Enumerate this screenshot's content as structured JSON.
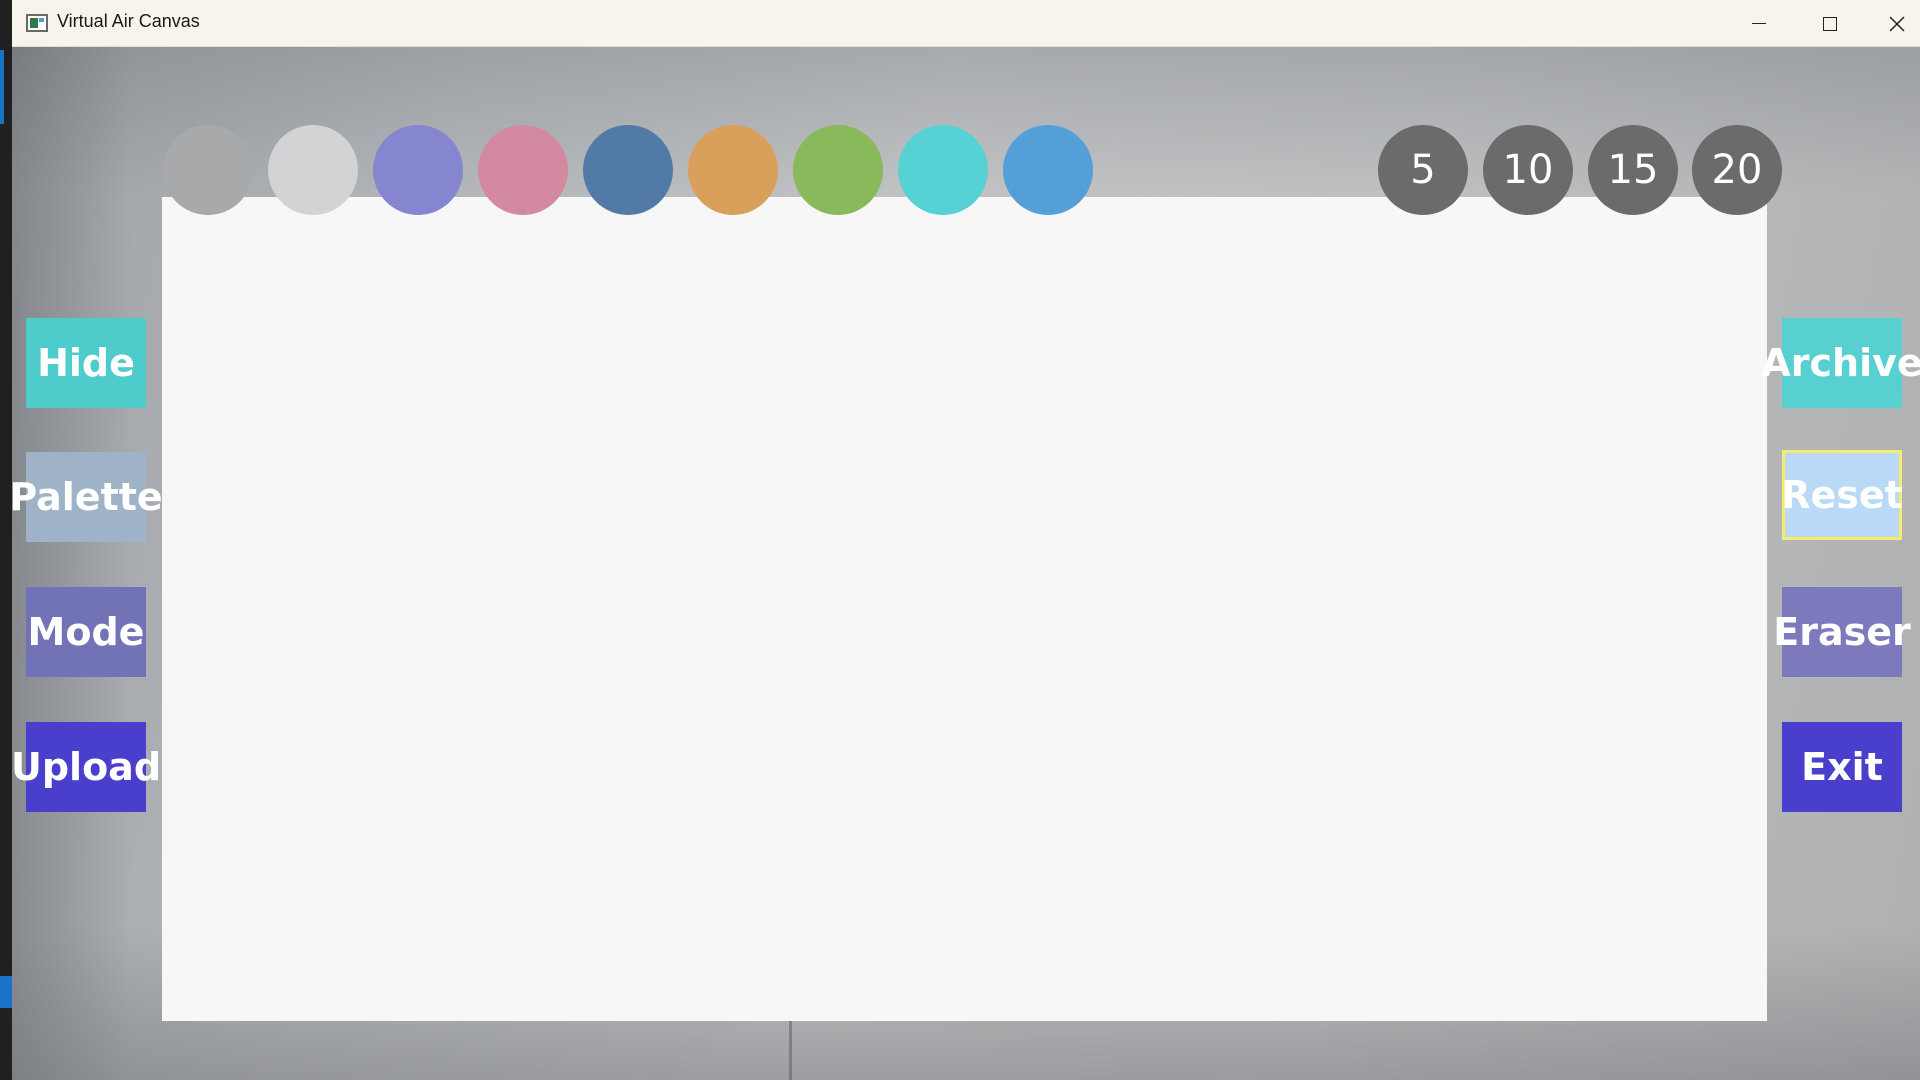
{
  "window": {
    "title": "Virtual Air Canvas",
    "icon": "app-window-icon",
    "controls": [
      "minimize-icon",
      "maximize-icon",
      "close-icon"
    ],
    "close_glyph": "✕"
  },
  "palette": {
    "colors": [
      {
        "name": "gray",
        "hex": "#a7a9ab"
      },
      {
        "name": "light-gray",
        "hex": "#d3d3d5"
      },
      {
        "name": "lavender",
        "hex": "#8585d0"
      },
      {
        "name": "pink",
        "hex": "#d38aa0"
      },
      {
        "name": "steel-blue",
        "hex": "#527aa6"
      },
      {
        "name": "orange",
        "hex": "#d8a05a"
      },
      {
        "name": "green",
        "hex": "#89b95a"
      },
      {
        "name": "cyan",
        "hex": "#56d2d4"
      },
      {
        "name": "sky-blue",
        "hex": "#559fd8"
      }
    ]
  },
  "brush_sizes": [
    "5",
    "10",
    "15",
    "20"
  ],
  "left_buttons": [
    {
      "label": "Hide",
      "color": "#4ecbcb"
    },
    {
      "label": "Palette",
      "color": "#9eb3c8"
    },
    {
      "label": "Mode",
      "color": "#7272b6"
    },
    {
      "label": "Upload",
      "color": "#4a3fcc"
    }
  ],
  "right_buttons": [
    {
      "label": "Archive",
      "color": "#58d0d2"
    },
    {
      "label": "Reset",
      "color": "#b9d9f7"
    },
    {
      "label": "Eraser",
      "color": "#7c79bc"
    },
    {
      "label": "Exit",
      "color": "#4a3fcc"
    }
  ]
}
